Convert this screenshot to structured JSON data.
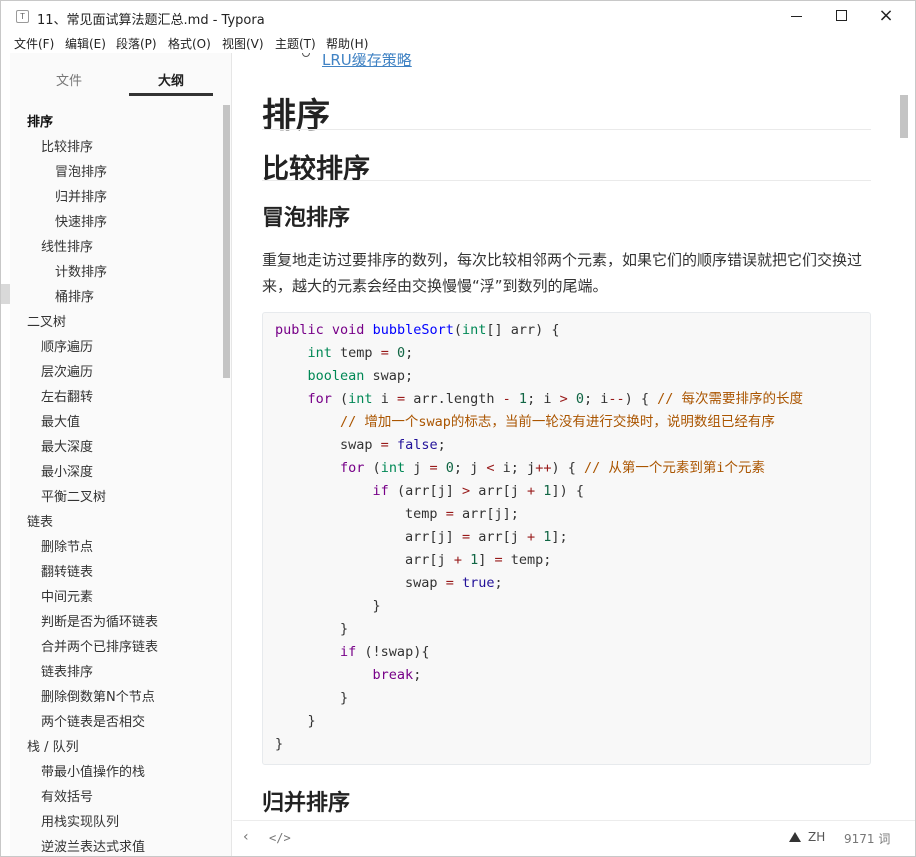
{
  "window": {
    "title": "11、常见面试算法题汇总.md - Typora",
    "app_icon": "T",
    "minimize": "minimize-icon",
    "maximize": "maximize-icon",
    "close": "×"
  },
  "menu": [
    "文件(F)",
    "编辑(E)",
    "段落(P)",
    "格式(O)",
    "视图(V)",
    "主题(T)",
    "帮助(H)"
  ],
  "sidebar": {
    "tabs": {
      "files": "文件",
      "outline": "大纲"
    },
    "outline": [
      {
        "label": "排序",
        "level": 1,
        "active": true
      },
      {
        "label": "比较排序",
        "level": 2
      },
      {
        "label": "冒泡排序",
        "level": 3
      },
      {
        "label": "归并排序",
        "level": 3
      },
      {
        "label": "快速排序",
        "level": 3
      },
      {
        "label": "线性排序",
        "level": 2
      },
      {
        "label": "计数排序",
        "level": 3
      },
      {
        "label": "桶排序",
        "level": 3
      },
      {
        "label": "二叉树",
        "level": 1
      },
      {
        "label": "顺序遍历",
        "level": 2
      },
      {
        "label": "层次遍历",
        "level": 2
      },
      {
        "label": "左右翻转",
        "level": 2
      },
      {
        "label": "最大值",
        "level": 2
      },
      {
        "label": "最大深度",
        "level": 2
      },
      {
        "label": "最小深度",
        "level": 2
      },
      {
        "label": "平衡二叉树",
        "level": 2
      },
      {
        "label": "链表",
        "level": 1
      },
      {
        "label": "删除节点",
        "level": 2
      },
      {
        "label": "翻转链表",
        "level": 2
      },
      {
        "label": "中间元素",
        "level": 2
      },
      {
        "label": "判断是否为循环链表",
        "level": 2
      },
      {
        "label": "合并两个已排序链表",
        "level": 2
      },
      {
        "label": "链表排序",
        "level": 2
      },
      {
        "label": "删除倒数第N个节点",
        "level": 2
      },
      {
        "label": "两个链表是否相交",
        "level": 2
      },
      {
        "label": "栈 / 队列",
        "level": 1
      },
      {
        "label": "带最小值操作的栈",
        "level": 2
      },
      {
        "label": "有效括号",
        "level": 2
      },
      {
        "label": "用栈实现队列",
        "level": 2
      },
      {
        "label": "逆波兰表达式求值",
        "level": 2
      }
    ]
  },
  "editor": {
    "toc_link": "LRU缓存策略",
    "h1": "排序",
    "h2": "比较排序",
    "h3": "冒泡排序",
    "paragraph": "重复地走访过要排序的数列，每次比较相邻两个元素，如果它们的顺序错误就把它们交换过来，越大的元素会经由交换慢慢“浮”到数列的尾端。",
    "code_lines": [
      "public void bubbleSort(int[] arr) {",
      "    int temp = 0;",
      "    boolean swap;",
      "    for (int i = arr.length - 1; i > 0; i--) { // 每次需要排序的长度",
      "        // 增加一个swap的标志，当前一轮没有进行交换时，说明数组已经有序",
      "        swap = false;",
      "        for (int j = 0; j < i; j++) { // 从第一个元素到第i个元素",
      "            if (arr[j] > arr[j + 1]) {",
      "                temp = arr[j];",
      "                arr[j] = arr[j + 1];",
      "                arr[j + 1] = temp;",
      "                swap = true;",
      "            }",
      "        }",
      "        if (!swap){",
      "            break;",
      "        }",
      "    }",
      "}"
    ],
    "h3_next": "归并排序"
  },
  "footer": {
    "prev": "‹",
    "source_mode": "</>",
    "warning_icon": "warning-icon",
    "lang": "ZH",
    "word_count": "9171 词"
  }
}
